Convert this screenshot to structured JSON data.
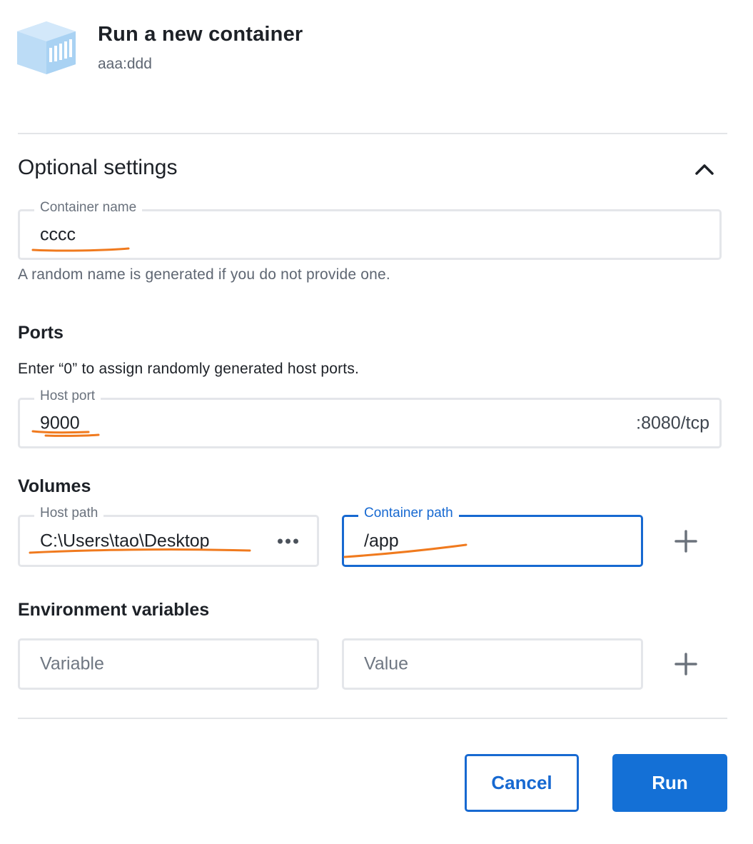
{
  "header": {
    "icon": "container-box-icon",
    "title": "Run a new container",
    "image": "aaa:ddd"
  },
  "optional_settings": {
    "title": "Optional settings",
    "collapse_icon": "chevron-up-icon"
  },
  "container_name": {
    "label": "Container name",
    "value": "cccc",
    "helper": "A random name is generated if you do not provide one."
  },
  "ports": {
    "title": "Ports",
    "description": "Enter “0” to assign randomly generated host ports.",
    "host_port_label": "Host port",
    "host_port_value": "9000",
    "container_port": ":8080/tcp"
  },
  "volumes": {
    "title": "Volumes",
    "host_path_label": "Host path",
    "host_path_value": "C:\\Users\\tao\\Desktop",
    "browse_icon": "more-horizontal-icon",
    "container_path_label": "Container path",
    "container_path_value": "/app",
    "add_icon": "plus-icon"
  },
  "environment": {
    "title": "Environment variables",
    "variable_placeholder": "Variable",
    "value_placeholder": "Value",
    "add_icon": "plus-icon"
  },
  "actions": {
    "cancel_label": "Cancel",
    "run_label": "Run"
  },
  "colors": {
    "primary": "#1470d6",
    "annotation": "#f07a1e",
    "icon_light_blue": "#b9dcf7"
  }
}
